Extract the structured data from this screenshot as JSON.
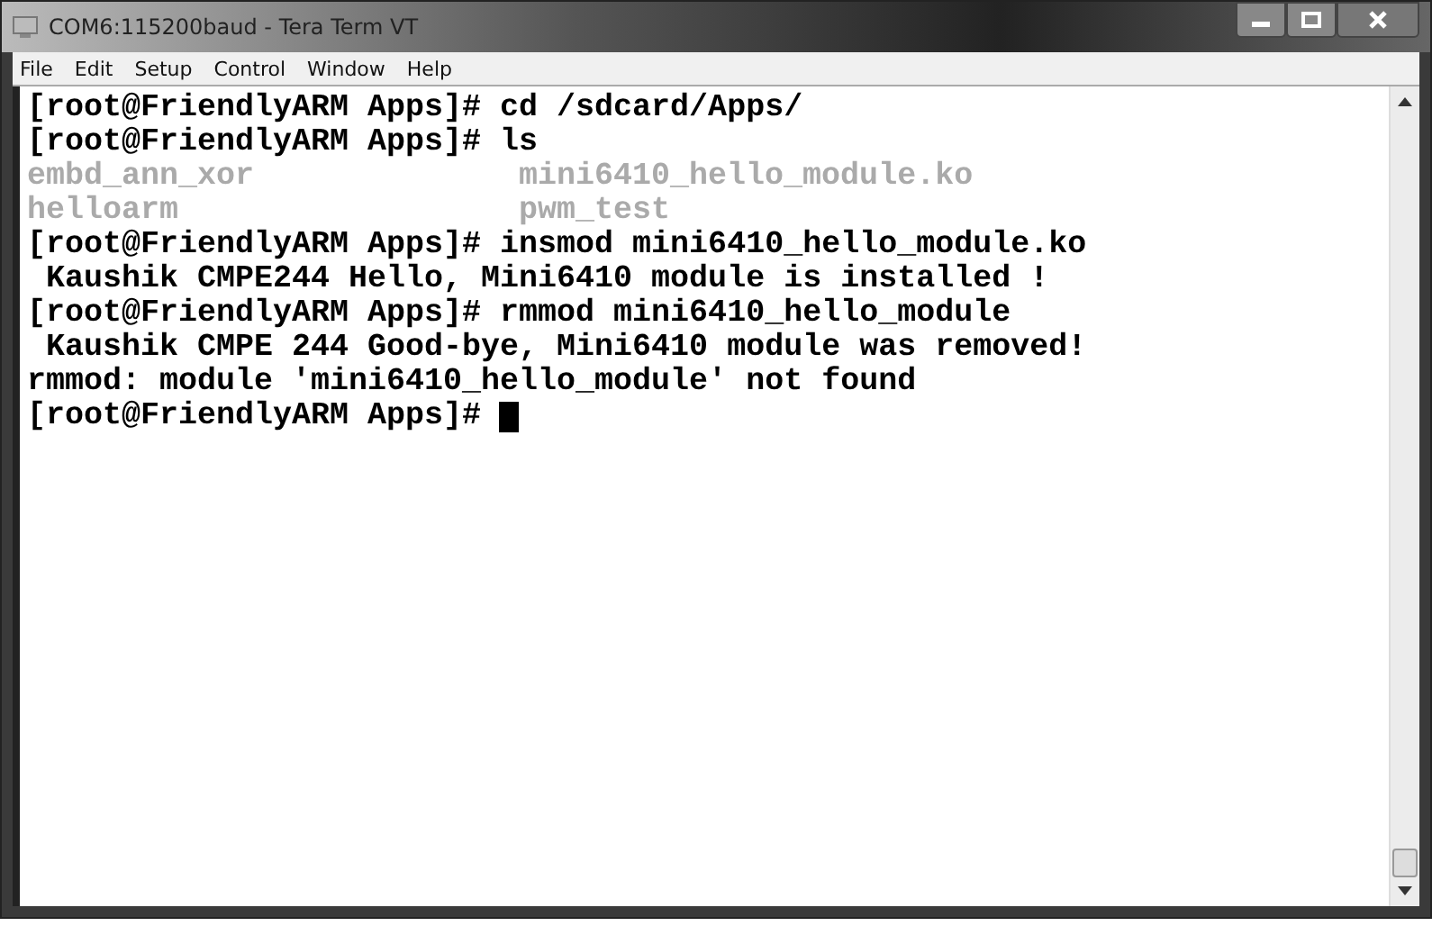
{
  "window": {
    "title": "COM6:115200baud - Tera Term VT"
  },
  "menu": [
    "File",
    "Edit",
    "Setup",
    "Control",
    "Window",
    "Help"
  ],
  "terminal": {
    "lines": [
      {
        "kind": "text",
        "text": "[root@FriendlyARM Apps]# cd /sdcard/Apps/"
      },
      {
        "kind": "text",
        "text": "[root@FriendlyARM Apps]# ls"
      },
      {
        "kind": "columns",
        "cells": [
          "embd_ann_xor",
          "mini6410_hello_module.ko"
        ]
      },
      {
        "kind": "columns",
        "cells": [
          "helloarm",
          "pwm_test"
        ]
      },
      {
        "kind": "text",
        "text": "[root@FriendlyARM Apps]# insmod mini6410_hello_module.ko"
      },
      {
        "kind": "text",
        "text": " Kaushik CMPE244 Hello, Mini6410 module is installed !"
      },
      {
        "kind": "text",
        "text": "[root@FriendlyARM Apps]# rmmod mini6410_hello_module"
      },
      {
        "kind": "text",
        "text": " Kaushik CMPE 244 Good-bye, Mini6410 module was removed!"
      },
      {
        "kind": "text",
        "text": "rmmod: module 'mini6410_hello_module' not found"
      },
      {
        "kind": "prompt",
        "text": "[root@FriendlyARM Apps]#"
      }
    ]
  }
}
